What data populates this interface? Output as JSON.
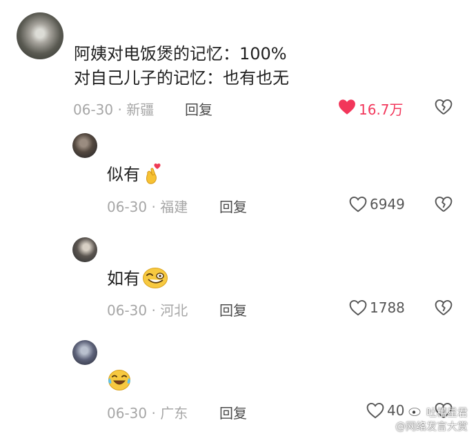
{
  "comment": {
    "lines": [
      "阿姨对电饭煲的记忆：100%",
      "对自己儿子的记忆：也有也无"
    ],
    "date": "06-30",
    "location": "新疆",
    "reply_label": "回复",
    "likes": "16.7万",
    "like_color": "#f2365a"
  },
  "replies": [
    {
      "text": "似有",
      "emoji": "finger-heart-emoji",
      "date": "06-30",
      "location": "福建",
      "reply_label": "回复",
      "likes": "6949"
    },
    {
      "text": "如有",
      "emoji": "grinning-face-emoji",
      "date": "06-30",
      "location": "河北",
      "reply_label": "回复",
      "likes": "1788"
    },
    {
      "text": "",
      "emoji": "crying-laughing-emoji",
      "date": "06-30",
      "location": "广东",
      "reply_label": "回复",
      "likes": "40"
    }
  ],
  "watermark": {
    "line1": "吐槽星君",
    "line2": "@网络发言大赏"
  }
}
